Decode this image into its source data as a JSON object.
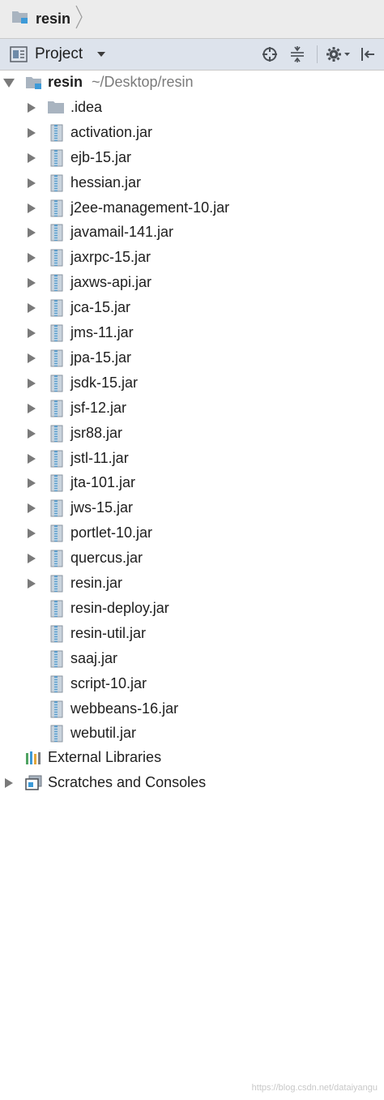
{
  "breadcrumb": {
    "label": "resin",
    "icon": "folder-module-icon"
  },
  "toolwindow": {
    "title": "Project",
    "tools": [
      "locate-icon",
      "collapse-all-icon",
      "gear-icon",
      "hide-icon"
    ]
  },
  "colors": {
    "header_bg": "#dde3ec",
    "breadcrumb_bg": "#ececec",
    "jar_stripe": "#5b9bc8",
    "folder": "#a9b4c0"
  },
  "tree": {
    "root": {
      "label": "resin",
      "path": "~/Desktop/resin",
      "expanded": true
    },
    "items": [
      {
        "label": ".idea",
        "kind": "folder",
        "expandable": true
      },
      {
        "label": "activation.jar",
        "kind": "jar",
        "expandable": true
      },
      {
        "label": "ejb-15.jar",
        "kind": "jar",
        "expandable": true
      },
      {
        "label": "hessian.jar",
        "kind": "jar",
        "expandable": true
      },
      {
        "label": "j2ee-management-10.jar",
        "kind": "jar",
        "expandable": true
      },
      {
        "label": "javamail-141.jar",
        "kind": "jar",
        "expandable": true
      },
      {
        "label": "jaxrpc-15.jar",
        "kind": "jar",
        "expandable": true
      },
      {
        "label": "jaxws-api.jar",
        "kind": "jar",
        "expandable": true
      },
      {
        "label": "jca-15.jar",
        "kind": "jar",
        "expandable": true
      },
      {
        "label": "jms-11.jar",
        "kind": "jar",
        "expandable": true
      },
      {
        "label": "jpa-15.jar",
        "kind": "jar",
        "expandable": true
      },
      {
        "label": "jsdk-15.jar",
        "kind": "jar",
        "expandable": true
      },
      {
        "label": "jsf-12.jar",
        "kind": "jar",
        "expandable": true
      },
      {
        "label": "jsr88.jar",
        "kind": "jar",
        "expandable": true
      },
      {
        "label": "jstl-11.jar",
        "kind": "jar",
        "expandable": true
      },
      {
        "label": "jta-101.jar",
        "kind": "jar",
        "expandable": true
      },
      {
        "label": "jws-15.jar",
        "kind": "jar",
        "expandable": true
      },
      {
        "label": "portlet-10.jar",
        "kind": "jar",
        "expandable": true
      },
      {
        "label": "quercus.jar",
        "kind": "jar",
        "expandable": true
      },
      {
        "label": "resin.jar",
        "kind": "jar",
        "expandable": true
      },
      {
        "label": "resin-deploy.jar",
        "kind": "jar",
        "expandable": false
      },
      {
        "label": "resin-util.jar",
        "kind": "jar",
        "expandable": false
      },
      {
        "label": "saaj.jar",
        "kind": "jar",
        "expandable": false
      },
      {
        "label": "script-10.jar",
        "kind": "jar",
        "expandable": false
      },
      {
        "label": "webbeans-16.jar",
        "kind": "jar",
        "expandable": false
      },
      {
        "label": "webutil.jar",
        "kind": "jar",
        "expandable": false
      }
    ],
    "external_libraries": {
      "label": "External Libraries"
    },
    "scratches": {
      "label": "Scratches and Consoles"
    }
  },
  "watermark": "https://blog.csdn.net/dataiyangu"
}
